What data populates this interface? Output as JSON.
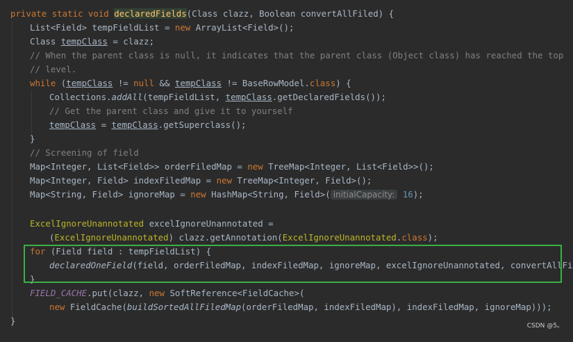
{
  "code": {
    "l1": [
      "private",
      "static",
      "void",
      "declaredFields",
      "(Class clazz, Boolean convertAllFiled) {"
    ],
    "l2": [
      "List<Field> tempFieldList = ",
      "new",
      " ArrayList<Field>();"
    ],
    "l3": [
      "Class ",
      "tempClass",
      " = clazz;"
    ],
    "l4": "// When the parent class is null, it indicates that the parent class (Object class) has reached the top",
    "l5": "// level.",
    "l6": [
      "while",
      " (",
      "tempClass",
      " != ",
      "null",
      " && ",
      "tempClass",
      " != BaseRowModel.",
      "class",
      ") {"
    ],
    "l7": [
      "Collections.",
      "addAll",
      "(tempFieldList, ",
      "tempClass",
      ".getDeclaredFields());"
    ],
    "l8": "// Get the parent class and give it to yourself",
    "l9": [
      "tempClass",
      " = ",
      "tempClass",
      ".getSuperclass();"
    ],
    "l10": "}",
    "l11": "// Screening of field",
    "l12": [
      "Map<Integer, List<Field>> orderFiledMap = ",
      "new",
      " TreeMap<Integer, List<Field>>();"
    ],
    "l13": [
      "Map<Integer, Field> indexFiledMap = ",
      "new",
      " TreeMap<Integer, Field>();"
    ],
    "l14": [
      "Map<String, Field> ignoreMap = ",
      "new",
      " HashMap<String, Field>(",
      "initialCapacity:",
      "16",
      ");"
    ],
    "l16": [
      "ExcelIgnoreUnannotated",
      " excelIgnoreUnannotated ="
    ],
    "l17": [
      "(",
      "ExcelIgnoreUnannotated",
      ") clazz.getAnnotation(",
      "ExcelIgnoreUnannotated",
      ".",
      "class",
      ");"
    ],
    "l18": [
      "for",
      " (Field field : tempFieldList) {"
    ],
    "l19": [
      "declaredOneField",
      "(field, orderFiledMap, indexFiledMap, ignoreMap, excelIgnoreUnannotated, convertAllFiled);"
    ],
    "l20": "}",
    "l21": [
      "FIELD_CACHE",
      ".put(clazz, ",
      "new",
      " SoftReference<FieldCache>("
    ],
    "l22": [
      "new",
      " FieldCache(",
      "buildSortedAllFiledMap",
      "(orderFiledMap, indexFiledMap), indexFiledMap, ignoreMap)));"
    ],
    "l23": "}"
  },
  "watermark": "CSDN @5。",
  "colors": {
    "background": "#2b2b2b",
    "text": "#a9b7c6",
    "keyword": "#cc7832",
    "method": "#ffc66d",
    "comment": "#808080",
    "number": "#6897bb",
    "static_field": "#9876aa",
    "annotation": "#bbb529",
    "selection_border": "#3cb044"
  }
}
